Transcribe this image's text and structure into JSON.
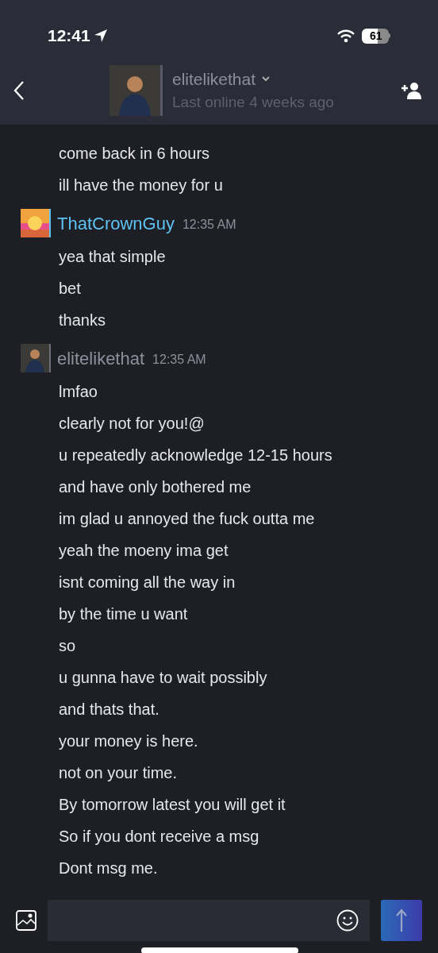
{
  "status_bar": {
    "time": "12:41",
    "battery": "61"
  },
  "header": {
    "name": "elitelikethat",
    "status": "Last online 4 weeks ago",
    "online": false
  },
  "messages": [
    {
      "lines": [
        "come back in 6 hours",
        "ill have the money for u"
      ]
    },
    {
      "sender": {
        "name": "ThatCrownGuy",
        "time": "12:35 AM",
        "online": true
      },
      "lines": [
        "yea that simple",
        "bet",
        "thanks"
      ]
    },
    {
      "sender": {
        "name": "elitelikethat",
        "time": "12:35 AM",
        "online": false
      },
      "lines": [
        "lmfao",
        "clearly not for you!@",
        "u repeatedly acknowledge 12-15 hours",
        "and have only bothered me",
        "im glad u annoyed the fuck outta me",
        "yeah the moeny ima get",
        "isnt coming all the way in",
        "by the time u want",
        "so",
        "u gunna have to wait possibly",
        "and thats that.",
        "your money is here.",
        "not on your time.",
        "By tomorrow latest you will get it",
        "So if you dont receive a msg",
        "Dont msg me."
      ]
    }
  ]
}
